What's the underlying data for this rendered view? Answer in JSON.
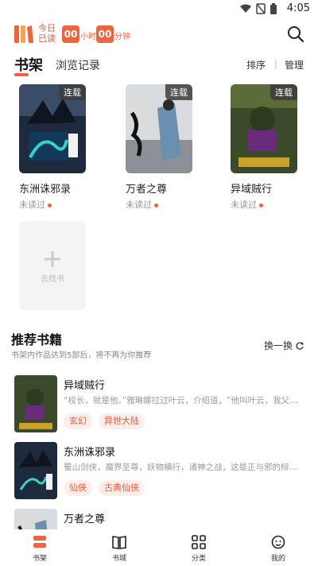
{
  "status": {
    "time": "4:05"
  },
  "header": {
    "reading_label_1": "今日",
    "reading_label_2": "已读",
    "hours": "00",
    "hours_unit": "小时",
    "minutes": "00",
    "minutes_unit": "分钟"
  },
  "tabs": {
    "shelf": "书架",
    "history": "浏览记录",
    "sort": "排序",
    "separator": "|",
    "manage": "管理"
  },
  "shelf": [
    {
      "title": "东洲诛邪录",
      "status": "未读过",
      "badge": "连载"
    },
    {
      "title": "万者之尊",
      "status": "未读过",
      "badge": "连载"
    },
    {
      "title": "异域贼行",
      "status": "未读过",
      "badge": "连载"
    }
  ],
  "add_card": {
    "label": "去找书"
  },
  "recommend": {
    "title": "推荐书籍",
    "subtitle": "书架内作品达到5部后，将不再为你推荐",
    "refresh": "换一换",
    "items": [
      {
        "name": "异域贼行",
        "desc": "“校长，就是他。”雅琳娜拉过叶云，介绍道，“他叫叶云，我父…",
        "tags": [
          "玄幻",
          "异世大陆"
        ]
      },
      {
        "name": "东洲诛邪录",
        "desc": "蜀山剑侠，魔界至尊，妖物横行，诸神之战，这是正与邪的辩…",
        "tags": [
          "仙侠",
          "古典仙侠"
        ]
      },
      {
        "name": "万者之尊",
        "desc": "",
        "tags": []
      }
    ]
  },
  "nav": {
    "shelf": "书架",
    "store": "书城",
    "category": "分类",
    "mine": "我的"
  },
  "colors": {
    "accent": "#f0633f",
    "tag_bg": "#fdeeea"
  }
}
